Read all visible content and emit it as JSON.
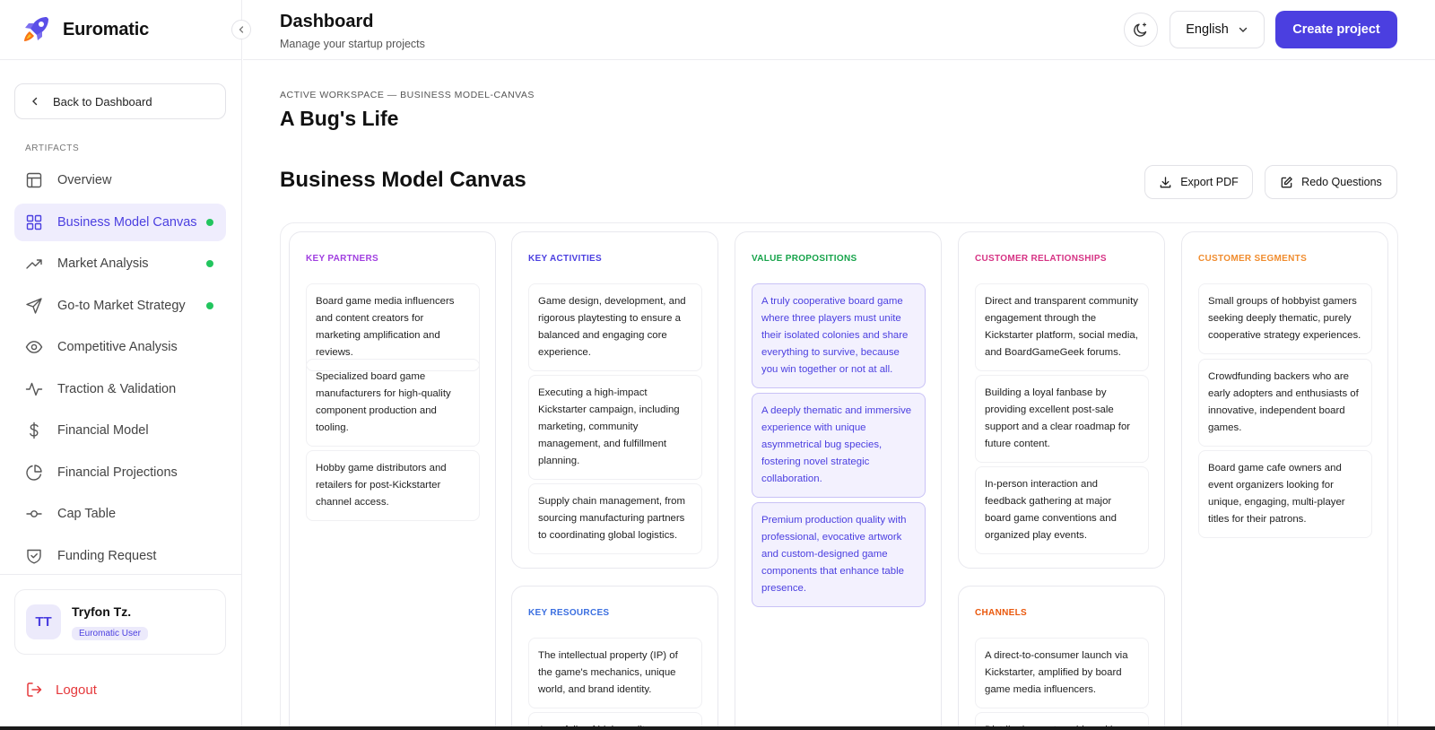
{
  "brand": {
    "name": "Euromatic"
  },
  "sidebar": {
    "back_label": "Back to Dashboard",
    "section_label": "ARTIFACTS",
    "items": [
      {
        "label": "Overview",
        "icon": "layout-icon",
        "active": false,
        "dot": false
      },
      {
        "label": "Business Model Canvas",
        "icon": "grid-icon",
        "active": true,
        "dot": true
      },
      {
        "label": "Market Analysis",
        "icon": "trending-up-icon",
        "active": false,
        "dot": true
      },
      {
        "label": "Go-to Market Strategy",
        "icon": "send-icon",
        "active": false,
        "dot": true
      },
      {
        "label": "Competitive Analysis",
        "icon": "eye-icon",
        "active": false,
        "dot": false
      },
      {
        "label": "Traction & Validation",
        "icon": "activity-icon",
        "active": false,
        "dot": false
      },
      {
        "label": "Financial Model",
        "icon": "dollar-icon",
        "active": false,
        "dot": false
      },
      {
        "label": "Financial Projections",
        "icon": "pie-chart-icon",
        "active": false,
        "dot": false
      },
      {
        "label": "Cap Table",
        "icon": "commit-icon",
        "active": false,
        "dot": false
      },
      {
        "label": "Funding Request",
        "icon": "shield-check-icon",
        "active": false,
        "dot": false
      }
    ],
    "user": {
      "initials": "TT",
      "name": "Tryfon Tz.",
      "role": "Euromatic User"
    },
    "logout_label": "Logout"
  },
  "header": {
    "title": "Dashboard",
    "subtitle": "Manage your startup projects",
    "language": "English",
    "create_label": "Create project"
  },
  "main": {
    "breadcrumb": "ACTIVE WORKSPACE — BUSINESS MODEL-CANVAS",
    "project_title": "A Bug's Life",
    "section_title": "Business Model Canvas",
    "export_label": "Export PDF",
    "redo_label": "Redo Questions"
  },
  "canvas": {
    "key_partners": {
      "label": "KEY PARTNERS",
      "color": "#a03ee0",
      "items": [
        "Board game media influencers and content creators for marketing amplification and reviews.",
        "Specialized board game manufacturers for high-quality component production and tooling.",
        "Hobby game distributors and retailers for post-Kickstarter channel access."
      ]
    },
    "key_activities": {
      "label": "KEY ACTIVITIES",
      "color": "#4b3fe0",
      "items": [
        "Game design, development, and rigorous playtesting to ensure a balanced and engaging core experience.",
        "Executing a high-impact Kickstarter campaign, including marketing, community management, and fulfillment planning.",
        "Supply chain management, from sourcing manufacturing partners to coordinating global logistics."
      ]
    },
    "key_resources": {
      "label": "KEY RESOURCES",
      "color": "#3b6fe0",
      "items": [
        "The intellectual property (IP) of the game's mechanics, unique world, and brand identity.",
        "A portfolio of high-quality"
      ]
    },
    "value_propositions": {
      "label": "VALUE PROPOSITIONS",
      "color": "#16a34a",
      "items": [
        "A truly cooperative board game where three players must unite their isolated colonies and share everything to survive, because you win together or not at all.",
        "A deeply thematic and immersive experience with unique asymmetrical bug species, fostering novel strategic collaboration.",
        "Premium production quality with professional, evocative artwork and custom-designed game components that enhance table presence."
      ]
    },
    "customer_relationships": {
      "label": "CUSTOMER RELATIONSHIPS",
      "color": "#d63384",
      "items": [
        "Direct and transparent community engagement through the Kickstarter platform, social media, and BoardGameGeek forums.",
        "Building a loyal fanbase by providing excellent post-sale support and a clear roadmap for future content.",
        "In-person interaction and feedback gathering at major board game conventions and organized play events."
      ]
    },
    "channels": {
      "label": "CHANNELS",
      "color": "#ea580c",
      "items": [
        "A direct-to-consumer launch via Kickstarter, amplified by board game media influencers.",
        "Distribution partnerships with"
      ]
    },
    "customer_segments": {
      "label": "CUSTOMER SEGMENTS",
      "color": "#f08c2e",
      "items": [
        "Small groups of hobbyist gamers seeking deeply thematic, purely cooperative strategy experiences.",
        "Crowdfunding backers who are early adopters and enthusiasts of innovative, independent board games.",
        "Board game cafe owners and event organizers looking for unique, engaging, multi-player titles for their patrons."
      ]
    }
  },
  "colors": {
    "accent": "#4b3fe0",
    "status_dot": "#22c55e",
    "danger": "#e5383b"
  }
}
